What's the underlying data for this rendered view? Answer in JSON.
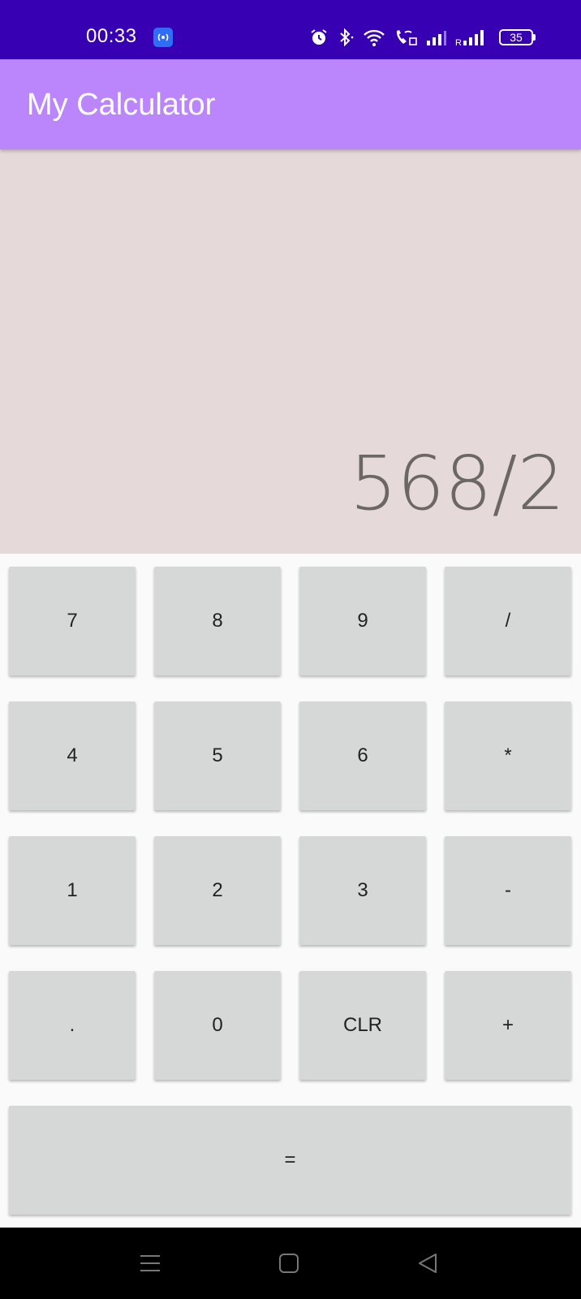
{
  "status_bar": {
    "time": "00:33",
    "battery": "35",
    "background": "#3700b3",
    "icons": [
      "hotspot-icon",
      "alarm-icon",
      "bluetooth-icon",
      "wifi-icon",
      "wifi-call-icon",
      "signal-icon",
      "roaming-signal-icon",
      "battery-icon"
    ]
  },
  "app_bar": {
    "title": "My Calculator",
    "background": "#bb86fc"
  },
  "display": {
    "expression": "568/2",
    "background": "#e6d9d9"
  },
  "keypad": {
    "rows": [
      [
        "7",
        "8",
        "9",
        "/"
      ],
      [
        "4",
        "5",
        "6",
        "*"
      ],
      [
        "1",
        "2",
        "3",
        "-"
      ],
      [
        ".",
        "0",
        "CLR",
        "+"
      ]
    ],
    "equals": "=",
    "key_color": "#d6d7d7"
  },
  "nav_bar": {
    "icons": [
      "menu-icon",
      "home-icon",
      "back-icon"
    ]
  }
}
